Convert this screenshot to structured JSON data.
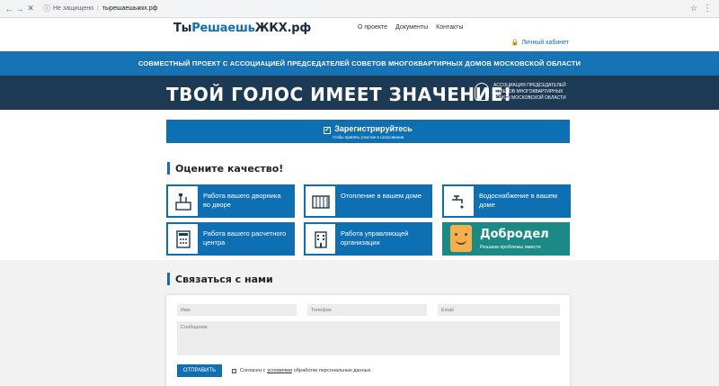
{
  "browser": {
    "back": "←",
    "forward": "→",
    "reload": "✕",
    "security": "Не защищено",
    "url": "тырешаешьжкх.рф"
  },
  "header": {
    "logo_part1": "Ты",
    "logo_part2": "Решаешь",
    "logo_part3": "ЖКХ.рф",
    "nav": [
      "О проекте",
      "Документы",
      "Контакты"
    ],
    "cabinet": "Личный кабинет"
  },
  "banner": {
    "project": "СОВМЕСТНЫЙ ПРОЕКТ С АССОЦИАЦИЕЙ ПРЕДСЕДАТЕЛЕЙ СОВЕТОВ МНОГОКВАРТИРНЫХ ДОМОВ МОСКОВСКОЙ ОБЛАСТИ",
    "slogan": "ТВОЙ ГОЛОС ИМЕЕТ ЗНАЧЕНИЕ!",
    "association": "АССОЦИАЦИЯ ПРЕДСЕДАТЕЛЕЙ СОВЕТОВ МНОГОКВАРТИРНЫХ ДОМОВ МОСКОВСКОЙ ОБЛАСТИ"
  },
  "register": {
    "label": "Зарегистрируйтесь",
    "sub": "чтобы принять участие в голосовании"
  },
  "rate": {
    "title": "Оцените качество!",
    "tiles": [
      {
        "label": "Работа вашего дворника во дворе",
        "icon": "janitor-icon"
      },
      {
        "label": "Отопление в вашем доме",
        "icon": "radiator-icon"
      },
      {
        "label": "Водоснабжение в вашем доме",
        "icon": "water-tap-icon"
      },
      {
        "label": "Работа вашего расчетного центра",
        "icon": "calculator-icon"
      },
      {
        "label": "Работа управляющей организации",
        "icon": "building-icon"
      }
    ],
    "dobrodel": {
      "name": "Добродел",
      "sub": "Решаем проблемы вместе"
    }
  },
  "contact": {
    "title": "Связаться с нами",
    "name_placeholder": "Имя",
    "phone_placeholder": "Телефон",
    "email_placeholder": "Email",
    "message_placeholder": "Сообщение",
    "send": "ОТПРАВИТЬ",
    "agree_pre": "Согласен с",
    "agree_link": "условиями",
    "agree_post": "обработки персональных данных"
  },
  "colors": {
    "brand_blue": "#0f6fb3",
    "dark_band": "#1d3a55",
    "dobrodel_teal": "#1b8a86"
  }
}
